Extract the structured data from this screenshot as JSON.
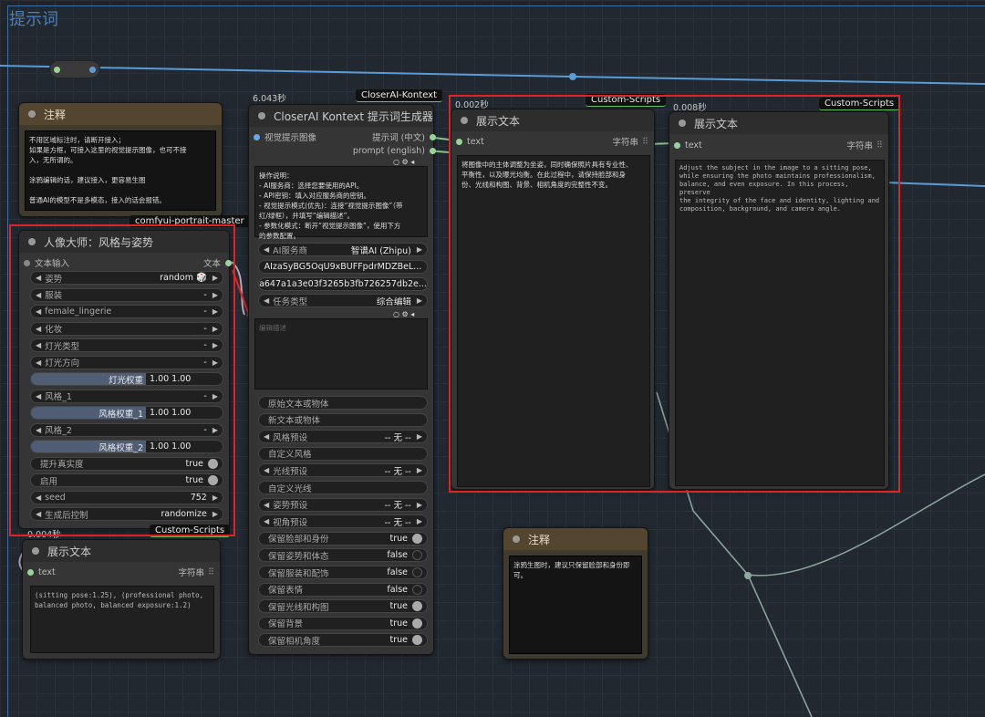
{
  "group": {
    "title": "提示词"
  },
  "note1": {
    "title": "注释",
    "text": "不用区域标注时，请断开接入；\n如果是方框，可接入这里的视觉提示图像，也可不接\n入，无所谓的。\n\n涂鸦编辑的话，建议接入，更容易生图\n\n普通AI的模型不是多模态，接入的话会报错。"
  },
  "note2": {
    "title": "注释",
    "text": "涂鸦生图时，建议只保留脸部和身份即\n可。"
  },
  "portrait_node": {
    "tag": "comfyui-portrait-master",
    "title": "人像大师：风格与姿势",
    "input_label": "文本输入",
    "output_label": "文本",
    "widgets": [
      {
        "label": "姿势",
        "value": "random 🎲",
        "type": "combo"
      },
      {
        "label": "服装",
        "value": "-",
        "type": "combo"
      },
      {
        "label": "female_lingerie",
        "value": "-",
        "type": "combo"
      },
      {
        "label": "化妆",
        "value": "-",
        "type": "combo"
      },
      {
        "label": "灯光类型",
        "value": "-",
        "type": "combo"
      },
      {
        "label": "灯光方向",
        "value": "-",
        "type": "combo"
      },
      {
        "label": "灯光权重",
        "value": "1.00  1.00",
        "type": "slider"
      },
      {
        "label": "风格_1",
        "value": "-",
        "type": "combo"
      },
      {
        "label": "风格权重_1",
        "value": "1.00  1.00",
        "type": "slider"
      },
      {
        "label": "风格_2",
        "value": "-",
        "type": "combo"
      },
      {
        "label": "风格权重_2",
        "value": "1.00  1.00",
        "type": "slider"
      },
      {
        "label": "提升真实度",
        "value": "true",
        "type": "toggle"
      },
      {
        "label": "启用",
        "value": "true",
        "type": "toggle"
      },
      {
        "label": "seed",
        "value": "752",
        "type": "combo"
      },
      {
        "label": "生成后控制",
        "value": "randomize",
        "type": "combo"
      }
    ],
    "footer_tag": "Custom-Scripts",
    "footer_timing": "0.004秒"
  },
  "closer_node": {
    "timing": "6.043秒",
    "tag": "CloserAI-Kontext",
    "title": "CloserAI Kontext 提示词生成器",
    "input_label": "视觉提示图像",
    "output_cn": "提示词 (中文)",
    "output_en": "prompt (english)",
    "instructions": "操作说明：\n- AI服务商：选择您要使用的API。\n- API密钥：填入对应服务商的密钥。\n- 视觉提示模式(优先)：连接“视觉提示图像”（带\n红/绿框），并填写“编辑描述”。\n- 参数化模式：断开“视觉提示图像”，使用下方\n的参数配置。",
    "service_label": "AI服务商",
    "service_value": "智谱AI (Zhipu)",
    "api_key": "AIzaSyBG5OqU9xBUFFpdrMDZBeL...",
    "secret": "a647a1a3e03f3265b3fb726257db2e...",
    "task_label": "任务类型",
    "task_value": "综合编辑",
    "edit_placeholder": "编辑描述",
    "fields": [
      {
        "label": "原始文本或物体",
        "value": "",
        "type": "text"
      },
      {
        "label": "新文本或物体",
        "value": "",
        "type": "text"
      },
      {
        "label": "风格预设",
        "value": "-- 无 --",
        "type": "combo"
      },
      {
        "label": "自定义风格",
        "value": "",
        "type": "text"
      },
      {
        "label": "光线预设",
        "value": "-- 无 --",
        "type": "combo"
      },
      {
        "label": "自定义光线",
        "value": "",
        "type": "text"
      },
      {
        "label": "姿势预设",
        "value": "-- 无 --",
        "type": "combo"
      },
      {
        "label": "视角预设",
        "value": "-- 无 --",
        "type": "combo"
      },
      {
        "label": "保留脸部和身份",
        "value": "true",
        "type": "toggle"
      },
      {
        "label": "保留姿势和体态",
        "value": "false",
        "type": "toggle"
      },
      {
        "label": "保留服装和配饰",
        "value": "false",
        "type": "toggle"
      },
      {
        "label": "保留表情",
        "value": "false",
        "type": "toggle"
      },
      {
        "label": "保留光线和构图",
        "value": "true",
        "type": "toggle"
      },
      {
        "label": "保留背景",
        "value": "true",
        "type": "toggle"
      },
      {
        "label": "保留相机角度",
        "value": "true",
        "type": "toggle"
      }
    ]
  },
  "show_text_cn": {
    "timing": "0.002秒",
    "tag": "Custom-Scripts",
    "title": "展示文本",
    "slot_label": "text",
    "slot_type": "字符串",
    "text": "将图像中的主体调整为坐姿，同时确保照片具有专业性、\n平衡性，以及曝光均衡。在此过程中，请保持脸部和身\n份、光线和构图、背景、相机角度的完整性不变。"
  },
  "show_text_en": {
    "timing": "0.008秒",
    "tag": "Custom-Scripts",
    "title": "展示文本",
    "slot_label": "text",
    "slot_type": "字符串",
    "text": "Adjust the subject in the image to a sitting pose,\nwhile ensuring the photo maintains professionalism,\nbalance, and even exposure. In this process, preserve\nthe integrity of the face and identity, lighting and\ncomposition, background, and camera angle."
  },
  "show_text_small": {
    "title": "展示文本",
    "slot_label": "text",
    "slot_type": "字符串",
    "text": "(sitting pose:1.25), (professional photo,\nbalanced photo, balanced exposure:1.2)"
  }
}
